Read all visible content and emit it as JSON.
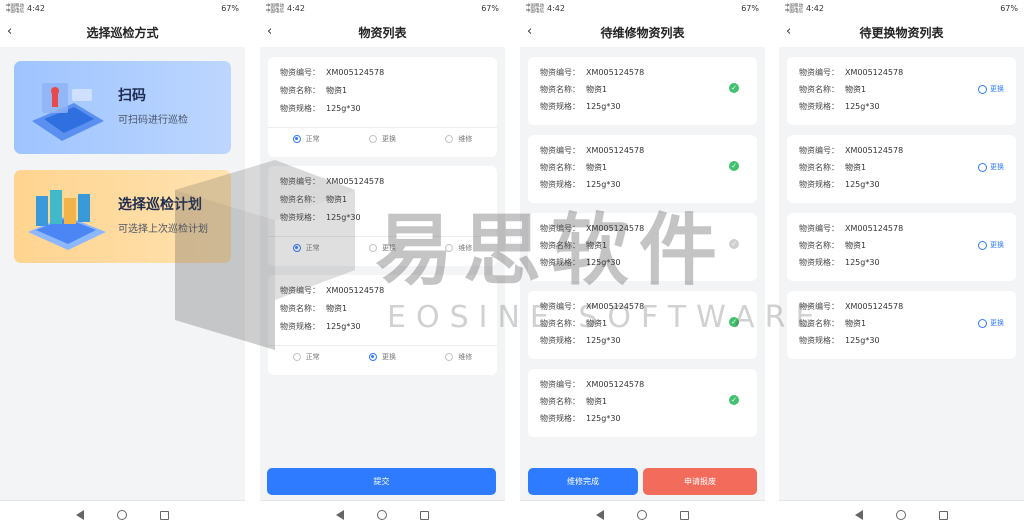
{
  "status": {
    "time": "4:42",
    "battery": "67%",
    "carrier_line1": "中国移动",
    "carrier_line2": "中国电信"
  },
  "screen1": {
    "title": "选择巡检方式",
    "modes": [
      {
        "title": "扫码",
        "subtitle": "可扫码进行巡检"
      },
      {
        "title": "选择巡检计划",
        "subtitle": "可选择上次巡检计划"
      }
    ]
  },
  "screen2": {
    "title": "物资列表",
    "radio_labels": [
      "正常",
      "更换",
      "维修"
    ],
    "items": [
      {
        "code_label": "物资编号：",
        "code": "XM005124578",
        "name_label": "物资名称：",
        "name": "物资1",
        "spec_label": "物资规格：",
        "spec": "125g*30",
        "selected": 0
      },
      {
        "code_label": "物资编号：",
        "code": "XM005124578",
        "name_label": "物资名称：",
        "name": "物资1",
        "spec_label": "物资规格：",
        "spec": "125g*30",
        "selected": 0
      },
      {
        "code_label": "物资编号：",
        "code": "XM005124578",
        "name_label": "物资名称：",
        "name": "物资1",
        "spec_label": "物资规格：",
        "spec": "125g*30",
        "selected": 1
      }
    ],
    "submit": "提交"
  },
  "screen3": {
    "title": "待维修物资列表",
    "items": [
      {
        "code_label": "物资编号：",
        "code": "XM005124578",
        "name_label": "物资名称：",
        "name": "物资1",
        "spec_label": "物资规格：",
        "spec": "125g*30",
        "checked": true
      },
      {
        "code_label": "物资编号：",
        "code": "XM005124578",
        "name_label": "物资名称：",
        "name": "物资1",
        "spec_label": "物资规格：",
        "spec": "125g*30",
        "checked": true
      },
      {
        "code_label": "物资编号：",
        "code": "XM005124578",
        "name_label": "物资名称：",
        "name": "物资1",
        "spec_label": "物资规格：",
        "spec": "125g*30",
        "checked": false
      },
      {
        "code_label": "物资编号：",
        "code": "XM005124578",
        "name_label": "物资名称：",
        "name": "物资1",
        "spec_label": "物资规格：",
        "spec": "125g*30",
        "checked": true
      },
      {
        "code_label": "物资编号：",
        "code": "XM005124578",
        "name_label": "物资名称：",
        "name": "物资1",
        "spec_label": "物资规格：",
        "spec": "125g*30",
        "checked": true
      }
    ],
    "btn_done": "维修完成",
    "btn_scrap": "申请报废"
  },
  "screen4": {
    "title": "待更换物资列表",
    "replace_label": "更换",
    "items": [
      {
        "code_label": "物资编号：",
        "code": "XM005124578",
        "name_label": "物资名称：",
        "name": "物资1",
        "spec_label": "物资规格：",
        "spec": "125g*30"
      },
      {
        "code_label": "物资编号：",
        "code": "XM005124578",
        "name_label": "物资名称：",
        "name": "物资1",
        "spec_label": "物资规格：",
        "spec": "125g*30"
      },
      {
        "code_label": "物资编号：",
        "code": "XM005124578",
        "name_label": "物资名称：",
        "name": "物资1",
        "spec_label": "物资规格：",
        "spec": "125g*30"
      },
      {
        "code_label": "物资编号：",
        "code": "XM005124578",
        "name_label": "物资名称：",
        "name": "物资1",
        "spec_label": "物资规格：",
        "spec": "125g*30"
      }
    ]
  },
  "watermark": {
    "cn": "易思软件",
    "en": "EOSINE SOFTWARE"
  },
  "colors": {
    "primary": "#2f7bff",
    "danger": "#f26b5b",
    "success": "#3fc26b",
    "page_bg": "#f3f4f6"
  },
  "icons": {
    "back": "chevron-left-icon",
    "check": "check-circle-icon",
    "replace": "refresh-icon",
    "nav": [
      "nav-back-icon",
      "nav-home-icon",
      "nav-recent-icon"
    ]
  }
}
